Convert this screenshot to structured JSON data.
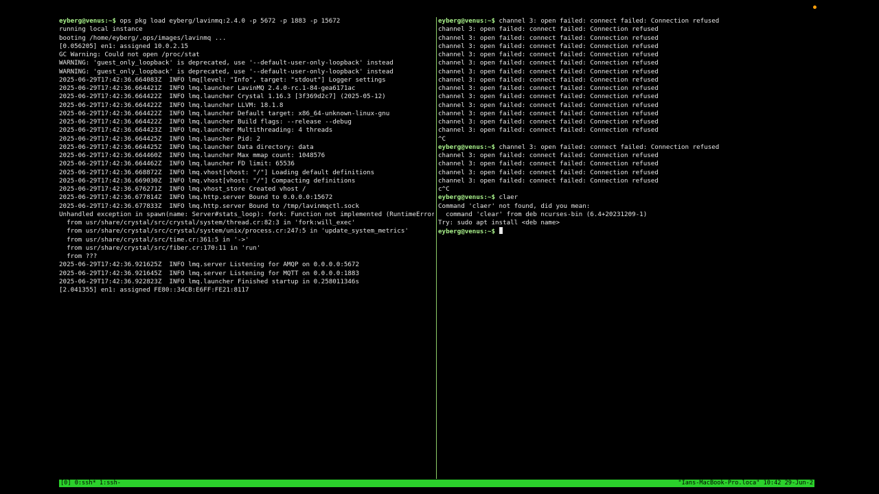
{
  "prompt": "eyberg@venus:~$",
  "left_lines": [
    {
      "prompt": true,
      "text": " ops pkg load eyberg/lavinmq:2.4.0 -p 5672 -p 1883 -p 15672"
    },
    {
      "text": "running local instance"
    },
    {
      "text": "booting /home/eyberg/.ops/images/lavinmq ..."
    },
    {
      "text": "[0.056205] en1: assigned 10.0.2.15"
    },
    {
      "text": "GC Warning: Could not open /proc/stat"
    },
    {
      "text": "WARNING: 'guest_only_loopback' is deprecated, use '--default-user-only-loopback' instead"
    },
    {
      "text": "WARNING: 'guest_only_loopback' is deprecated, use '--default-user-only-loopback' instead"
    },
    {
      "text": "2025-06-29T17:42:36.664083Z  INFO lmq[level: \"Info\", target: \"stdout\"] Logger settings"
    },
    {
      "text": "2025-06-29T17:42:36.664421Z  INFO lmq.launcher LavinMQ 2.4.0-rc.1-84-gea6171ac"
    },
    {
      "text": "2025-06-29T17:42:36.664422Z  INFO lmq.launcher Crystal 1.16.3 [3f369d2c7] (2025-05-12)"
    },
    {
      "text": "2025-06-29T17:42:36.664422Z  INFO lmq.launcher LLVM: 18.1.8"
    },
    {
      "text": "2025-06-29T17:42:36.664422Z  INFO lmq.launcher Default target: x86_64-unknown-linux-gnu"
    },
    {
      "text": "2025-06-29T17:42:36.664422Z  INFO lmq.launcher Build flags: --release --debug"
    },
    {
      "text": "2025-06-29T17:42:36.664423Z  INFO lmq.launcher Multithreading: 4 threads"
    },
    {
      "text": "2025-06-29T17:42:36.664425Z  INFO lmq.launcher Pid: 2"
    },
    {
      "text": "2025-06-29T17:42:36.664425Z  INFO lmq.launcher Data directory: data"
    },
    {
      "text": "2025-06-29T17:42:36.664460Z  INFO lmq.launcher Max mmap count: 1048576"
    },
    {
      "text": "2025-06-29T17:42:36.664462Z  INFO lmq.launcher FD limit: 65536"
    },
    {
      "text": "2025-06-29T17:42:36.668872Z  INFO lmq.vhost[vhost: \"/\"] Loading default definitions"
    },
    {
      "text": "2025-06-29T17:42:36.669030Z  INFO lmq.vhost[vhost: \"/\"] Compacting definitions"
    },
    {
      "text": "2025-06-29T17:42:36.676271Z  INFO lmq.vhost_store Created vhost /"
    },
    {
      "text": "2025-06-29T17:42:36.677814Z  INFO lmq.http.server Bound to 0.0.0.0:15672"
    },
    {
      "text": "2025-06-29T17:42:36.677833Z  INFO lmq.http.server Bound to /tmp/lavinmqctl.sock"
    },
    {
      "text": "Unhandled exception in spawn(name: Server#stats_loop): fork: Function not implemented (RuntimeError)"
    },
    {
      "text": "  from usr/share/crystal/src/crystal/system/thread.cr:82:3 in 'fork:will_exec'"
    },
    {
      "text": "  from usr/share/crystal/src/crystal/system/unix/process.cr:247:5 in 'update_system_metrics'"
    },
    {
      "text": "  from usr/share/crystal/src/time.cr:361:5 in '->'"
    },
    {
      "text": "  from usr/share/crystal/src/fiber.cr:170:11 in 'run'"
    },
    {
      "text": "  from ???"
    },
    {
      "text": "2025-06-29T17:42:36.921625Z  INFO lmq.server Listening for AMQP on 0.0.0.0:5672"
    },
    {
      "text": "2025-06-29T17:42:36.921645Z  INFO lmq.server Listening for MQTT on 0.0.0.0:1883"
    },
    {
      "text": "2025-06-29T17:42:36.922823Z  INFO lmq.launcher Finished startup in 0.258011346s"
    },
    {
      "text": "[2.041355] en1: assigned FE80::34CB:E6FF:FE21:8117"
    }
  ],
  "right_lines": [
    {
      "prompt": true,
      "text": " channel 3: open failed: connect failed: Connection refused"
    },
    {
      "text": "channel 3: open failed: connect failed: Connection refused"
    },
    {
      "text": "channel 3: open failed: connect failed: Connection refused"
    },
    {
      "text": "channel 3: open failed: connect failed: Connection refused"
    },
    {
      "text": "channel 3: open failed: connect failed: Connection refused"
    },
    {
      "text": "channel 3: open failed: connect failed: Connection refused"
    },
    {
      "text": "channel 3: open failed: connect failed: Connection refused"
    },
    {
      "text": "channel 3: open failed: connect failed: Connection refused"
    },
    {
      "text": "channel 3: open failed: connect failed: Connection refused"
    },
    {
      "text": "channel 3: open failed: connect failed: Connection refused"
    },
    {
      "text": "channel 3: open failed: connect failed: Connection refused"
    },
    {
      "text": "channel 3: open failed: connect failed: Connection refused"
    },
    {
      "text": "channel 3: open failed: connect failed: Connection refused"
    },
    {
      "text": "channel 3: open failed: connect failed: Connection refused"
    },
    {
      "text": "^C"
    },
    {
      "prompt": true,
      "text": " channel 3: open failed: connect failed: Connection refused"
    },
    {
      "text": "channel 3: open failed: connect failed: Connection refused"
    },
    {
      "text": "channel 3: open failed: connect failed: Connection refused"
    },
    {
      "text": "channel 3: open failed: connect failed: Connection refused"
    },
    {
      "text": "channel 3: open failed: connect failed: Connection refused"
    },
    {
      "text": "c^C"
    },
    {
      "prompt": true,
      "text": " claer"
    },
    {
      "text": "Command 'claer' not found, did you mean:"
    },
    {
      "text": "  command 'clear' from deb ncurses-bin (6.4+20231209-1)"
    },
    {
      "text": "Try: sudo apt install <deb name>"
    },
    {
      "prompt": true,
      "text": " ",
      "cursor": true
    }
  ],
  "status_bar": {
    "left": "[0] 0:ssh* 1:ssh-",
    "right": "\"Ians-MacBook-Pro.loca\" 10:42 29-Jun-2"
  }
}
